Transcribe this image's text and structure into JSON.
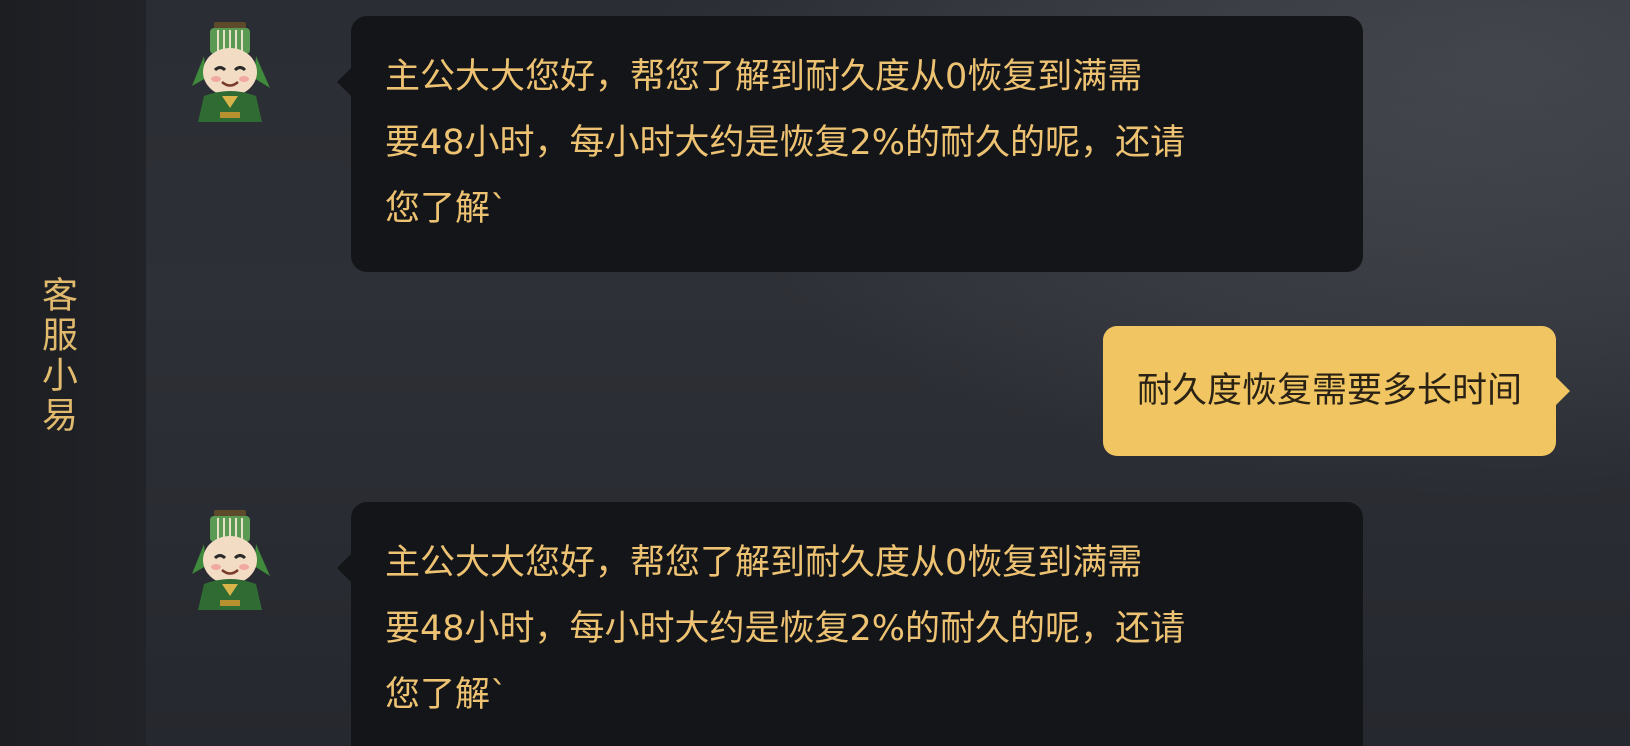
{
  "sidebar": {
    "title": "客服小易"
  },
  "messages": [
    {
      "sender": "agent",
      "lines": [
        "主公大大您好，帮您了解到耐久度从0恢复到满需",
        "要48小时，每小时大约是恢复2%的耐久的呢，还请",
        "您了解`"
      ]
    },
    {
      "sender": "user",
      "text": "耐久度恢复需要多长时间"
    },
    {
      "sender": "agent",
      "lines": [
        "主公大大您好，帮您了解到耐久度从0恢复到满需",
        "要48小时，每小时大约是恢复2%的耐久的呢，还请",
        "您了解`"
      ]
    }
  ],
  "colors": {
    "accent": "#e1ba6e",
    "agent_bubble": "#141518",
    "user_bubble": "#f1c662"
  }
}
